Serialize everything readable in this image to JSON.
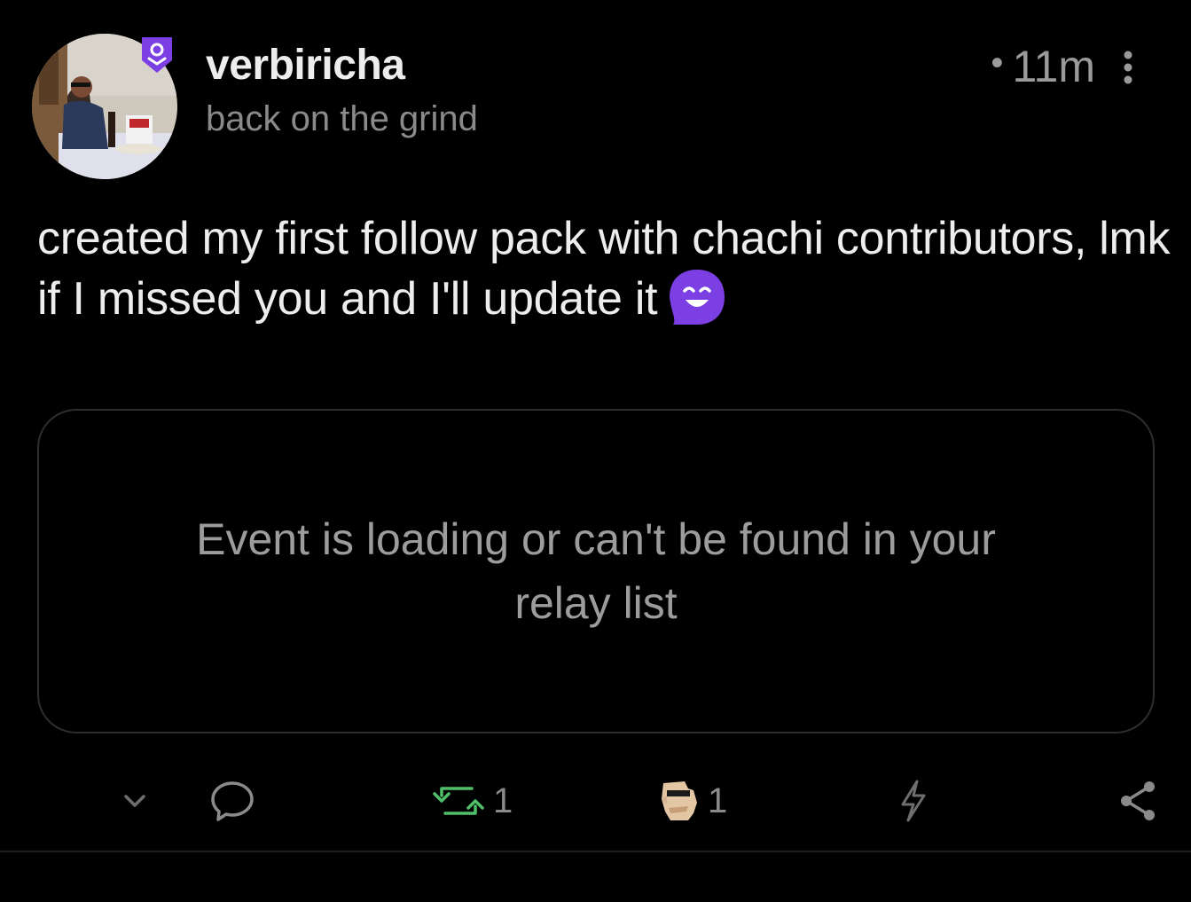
{
  "post": {
    "author": {
      "username": "verbiricha",
      "status": "back on the grind",
      "avatar_icon": "avatar-photo",
      "badge_icon": "verified-badge-icon"
    },
    "time_ago": "11m",
    "content_text": "created my first follow pack with chachi contributors, lmk if I missed you and I'll update it",
    "content_emoji": "smiling-face-emoji",
    "embed": {
      "message": "Event is loading or can't be found in your relay list"
    },
    "actions": {
      "expand_icon": "chevron-down-icon",
      "reply_icon": "reply-bubble-icon",
      "repost_icon": "repost-icon",
      "repost_count": "1",
      "reaction_icon": "custom-reaction-emoji",
      "reaction_count": "1",
      "zap_icon": "zap-icon",
      "share_icon": "share-icon"
    }
  },
  "colors": {
    "background": "#000000",
    "accent_purple": "#7b3fe4",
    "repost_green": "#4fbf6a",
    "muted_text": "#8a8a8a"
  }
}
